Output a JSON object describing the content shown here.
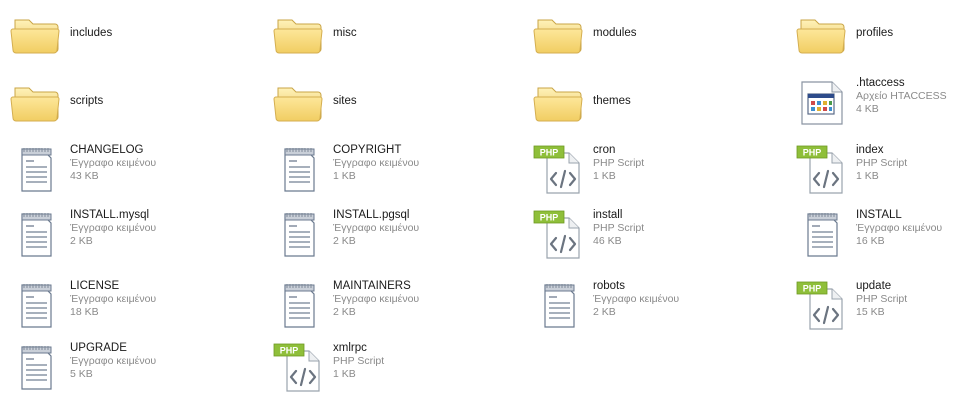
{
  "view": {
    "items": [
      {
        "name": "includes",
        "type": "folder"
      },
      {
        "name": "misc",
        "type": "folder"
      },
      {
        "name": "modules",
        "type": "folder"
      },
      {
        "name": "profiles",
        "type": "folder"
      },
      {
        "name": "scripts",
        "type": "folder"
      },
      {
        "name": "sites",
        "type": "folder"
      },
      {
        "name": "themes",
        "type": "folder"
      },
      {
        "name": ".htaccess",
        "type": "htaccess",
        "kind": "Αρχείο HTACCESS",
        "size": "4 KB"
      },
      {
        "name": "CHANGELOG",
        "type": "text",
        "kind": "Έγγραφο κειμένου",
        "size": "43 KB"
      },
      {
        "name": "COPYRIGHT",
        "type": "text",
        "kind": "Έγγραφο κειμένου",
        "size": "1 KB"
      },
      {
        "name": "cron",
        "type": "php",
        "kind": "PHP Script",
        "size": "1 KB"
      },
      {
        "name": "index",
        "type": "php",
        "kind": "PHP Script",
        "size": "1 KB"
      },
      {
        "name": "INSTALL.mysql",
        "type": "text",
        "kind": "Έγγραφο κειμένου",
        "size": "2 KB"
      },
      {
        "name": "INSTALL.pgsql",
        "type": "text",
        "kind": "Έγγραφο κειμένου",
        "size": "2 KB"
      },
      {
        "name": "install",
        "type": "php",
        "kind": "PHP Script",
        "size": "46 KB"
      },
      {
        "name": "INSTALL",
        "type": "text",
        "kind": "Έγγραφο κειμένου",
        "size": "16 KB"
      },
      {
        "name": "LICENSE",
        "type": "text",
        "kind": "Έγγραφο κειμένου",
        "size": "18 KB"
      },
      {
        "name": "MAINTAINERS",
        "type": "text",
        "kind": "Έγγραφο κειμένου",
        "size": "2 KB"
      },
      {
        "name": "robots",
        "type": "text",
        "kind": "Έγγραφο κειμένου",
        "size": "2 KB"
      },
      {
        "name": "update",
        "type": "php",
        "kind": "PHP Script",
        "size": "15 KB"
      },
      {
        "name": "UPGRADE",
        "type": "text",
        "kind": "Έγγραφο κειμένου",
        "size": "5 KB"
      },
      {
        "name": "xmlrpc",
        "type": "php",
        "kind": "PHP Script",
        "size": "1 KB"
      }
    ]
  },
  "icons": {
    "folder": "folder-icon",
    "text": "text-document-icon",
    "php": "php-script-icon",
    "htaccess": "htaccess-file-icon"
  },
  "colors": {
    "name_text": "#1a1a1a",
    "detail_text": "#8a8a8a",
    "folder_fill": "#f6d774",
    "php_badge": "#8fbf3a"
  }
}
